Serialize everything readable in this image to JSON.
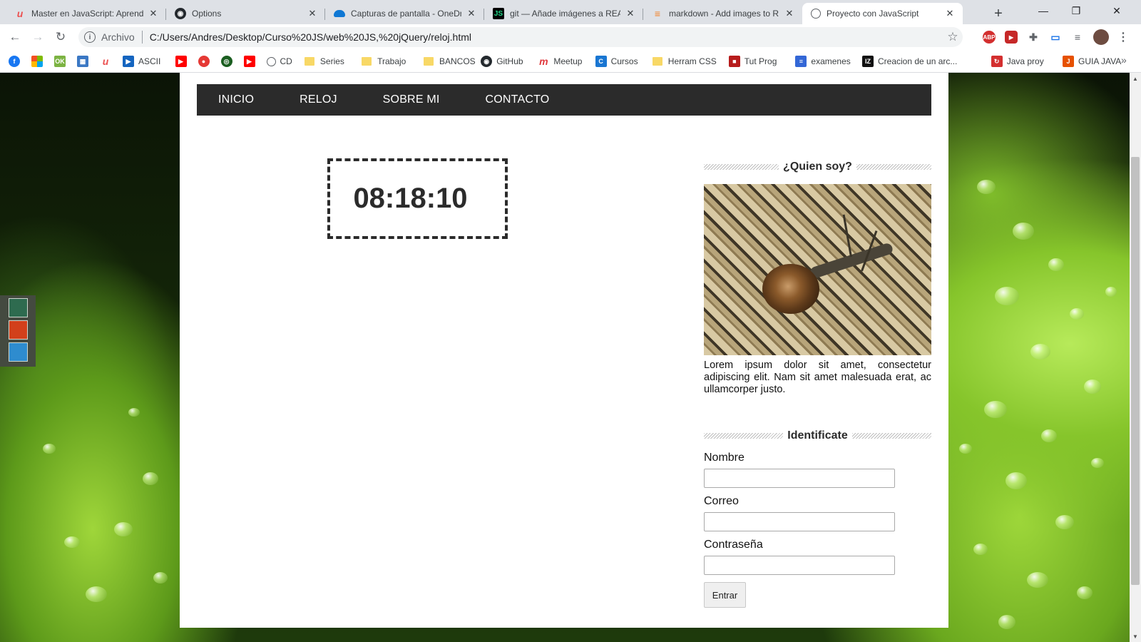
{
  "tabs": [
    {
      "title": "Master en JavaScript: Aprender",
      "favicon": "udemy-icon",
      "color": "#ec5252",
      "active": false
    },
    {
      "title": "Options",
      "favicon": "github-icon",
      "color": "#24292e",
      "active": false
    },
    {
      "title": "Capturas de pantalla - OneDriv",
      "favicon": "onedrive-icon",
      "color": "#0f78d4",
      "active": false
    },
    {
      "title": "git — Añade imágenes a READ",
      "favicon": "jetbrains-icon",
      "color": "#000000",
      "active": false
    },
    {
      "title": "markdown - Add images to RE",
      "favicon": "stackoverflow-icon",
      "color": "#f48024",
      "active": false
    },
    {
      "title": "Proyecto con JavaScript",
      "favicon": "globe-icon",
      "color": "#5f6368",
      "active": true
    }
  ],
  "window_controls": {
    "minimize": "—",
    "restore": "❐",
    "close": "✕"
  },
  "address_bar": {
    "security_label": "Archivo",
    "url": "C:/Users/Andres/Desktop/Curso%20JS/web%20JS,%20jQuery/reloj.html"
  },
  "bookmarks": [
    {
      "label": "",
      "icon": "facebook-icon",
      "color": "#1877f2"
    },
    {
      "label": "",
      "icon": "microsoft-icon",
      "color": "#f25022"
    },
    {
      "label": "",
      "icon": "ok-icon",
      "color": "#7cb342"
    },
    {
      "label": "",
      "icon": "grid-icon",
      "color": "#3b78c4"
    },
    {
      "label": "",
      "icon": "udemy-icon",
      "color": "#ec5252"
    },
    {
      "label": "ASCII",
      "icon": "arrow-icon",
      "color": "#1565c0"
    },
    {
      "label": "",
      "icon": "youtube-icon",
      "color": "#ff0000"
    },
    {
      "label": "",
      "icon": "pin-icon",
      "color": "#e53935"
    },
    {
      "label": "",
      "icon": "record-icon",
      "color": "#1b5e20"
    },
    {
      "label": "",
      "icon": "youtube-icon",
      "color": "#ff0000"
    },
    {
      "label": "CD",
      "icon": "globe-icon",
      "color": "#5f6368"
    },
    {
      "label": "Series",
      "icon": "folder-icon",
      "color": "#f8d866"
    },
    {
      "label": "Trabajo",
      "icon": "folder-icon",
      "color": "#f8d866"
    },
    {
      "label": "BANCOS",
      "icon": "folder-icon",
      "color": "#f8d866"
    },
    {
      "label": "GitHub",
      "icon": "github-icon",
      "color": "#24292e"
    },
    {
      "label": "Meetup",
      "icon": "meetup-icon",
      "color": "#e0393e"
    },
    {
      "label": "Cursos",
      "icon": "cursos-icon",
      "color": "#1976d2"
    },
    {
      "label": "Herram CSS",
      "icon": "folder-icon",
      "color": "#f8d866"
    },
    {
      "label": "Tut Prog",
      "icon": "book-icon",
      "color": "#b71c1c"
    },
    {
      "label": "examenes",
      "icon": "forms-icon",
      "color": "#3367d6"
    },
    {
      "label": "Creacion de un arc...",
      "icon": "izc-icon",
      "color": "#111111"
    },
    {
      "label": "Java proy",
      "icon": "refresh-icon",
      "color": "#d32f2f"
    },
    {
      "label": "GUIA JAVA",
      "icon": "java-icon",
      "color": "#e65100"
    }
  ],
  "nav": [
    "INICIO",
    "RELOJ",
    "SOBRE MI",
    "CONTACTO"
  ],
  "clock": {
    "time": "08:18:10"
  },
  "sidebar": {
    "about_title": "¿Quien soy?",
    "about_image": "snail-photo",
    "about_text": "Lorem ipsum dolor sit amet, consectetur adipiscing elit. Nam sit amet malesuada erat, ac ullamcorper justo.",
    "form_title": "Identificate",
    "fields": [
      {
        "label": "Nombre",
        "value": ""
      },
      {
        "label": "Correo",
        "value": ""
      },
      {
        "label": "Contraseña",
        "value": ""
      }
    ],
    "submit_label": "Entrar"
  },
  "theme_swatches": [
    "#2e6b4f",
    "#d2401b",
    "#2e8ccf"
  ]
}
